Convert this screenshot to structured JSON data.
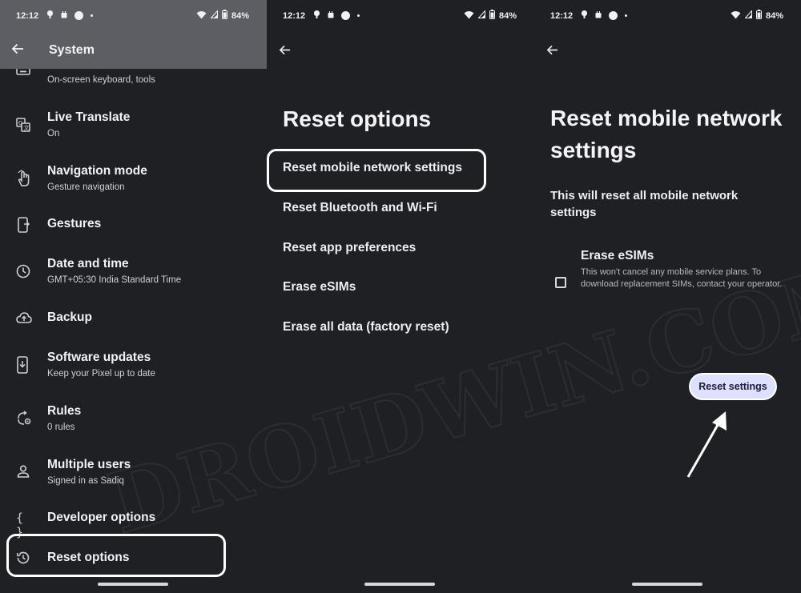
{
  "status_bar": {
    "time": "12:12",
    "battery": "84%"
  },
  "panel_system": {
    "title": "System",
    "partial_item_sub": "On-screen keyboard, tools",
    "items": [
      {
        "label": "Live Translate",
        "sub": "On",
        "icon": "translate-icon"
      },
      {
        "label": "Navigation mode",
        "sub": "Gesture navigation",
        "icon": "gesture-hand-icon"
      },
      {
        "label": "Gestures",
        "sub": "",
        "icon": "phone-gesture-icon"
      },
      {
        "label": "Date and time",
        "sub": "GMT+05:30 India Standard Time",
        "icon": "clock-icon"
      },
      {
        "label": "Backup",
        "sub": "",
        "icon": "cloud-upload-icon"
      },
      {
        "label": "Software updates",
        "sub": "Keep your Pixel up to date",
        "icon": "system-update-icon"
      },
      {
        "label": "Rules",
        "sub": "0 rules",
        "icon": "rules-icon"
      },
      {
        "label": "Multiple users",
        "sub": "Signed in as Sadiq",
        "icon": "person-icon"
      },
      {
        "label": "Developer options",
        "sub": "",
        "icon": "braces-icon"
      },
      {
        "label": "Reset options",
        "sub": "",
        "icon": "history-icon"
      }
    ]
  },
  "panel_reset": {
    "heading": "Reset options",
    "options": [
      "Reset mobile network settings",
      "Reset Bluetooth and Wi-Fi",
      "Reset app preferences",
      "Erase eSIMs",
      "Erase all data (factory reset)"
    ]
  },
  "panel_network": {
    "heading": "Reset mobile network settings",
    "description": "This will reset all mobile network settings",
    "esim_label": "Erase eSIMs",
    "esim_sub": "This won't cancel any mobile service plans. To download replacement SIMs, contact your operator.",
    "esim_checked": false,
    "reset_button": "Reset settings"
  },
  "watermark": "DROIDWIN.COM",
  "colors": {
    "background": "#1f2024",
    "appbar": "#5d5e63",
    "button": "#dde1ff",
    "highlight": "#ffffff"
  }
}
